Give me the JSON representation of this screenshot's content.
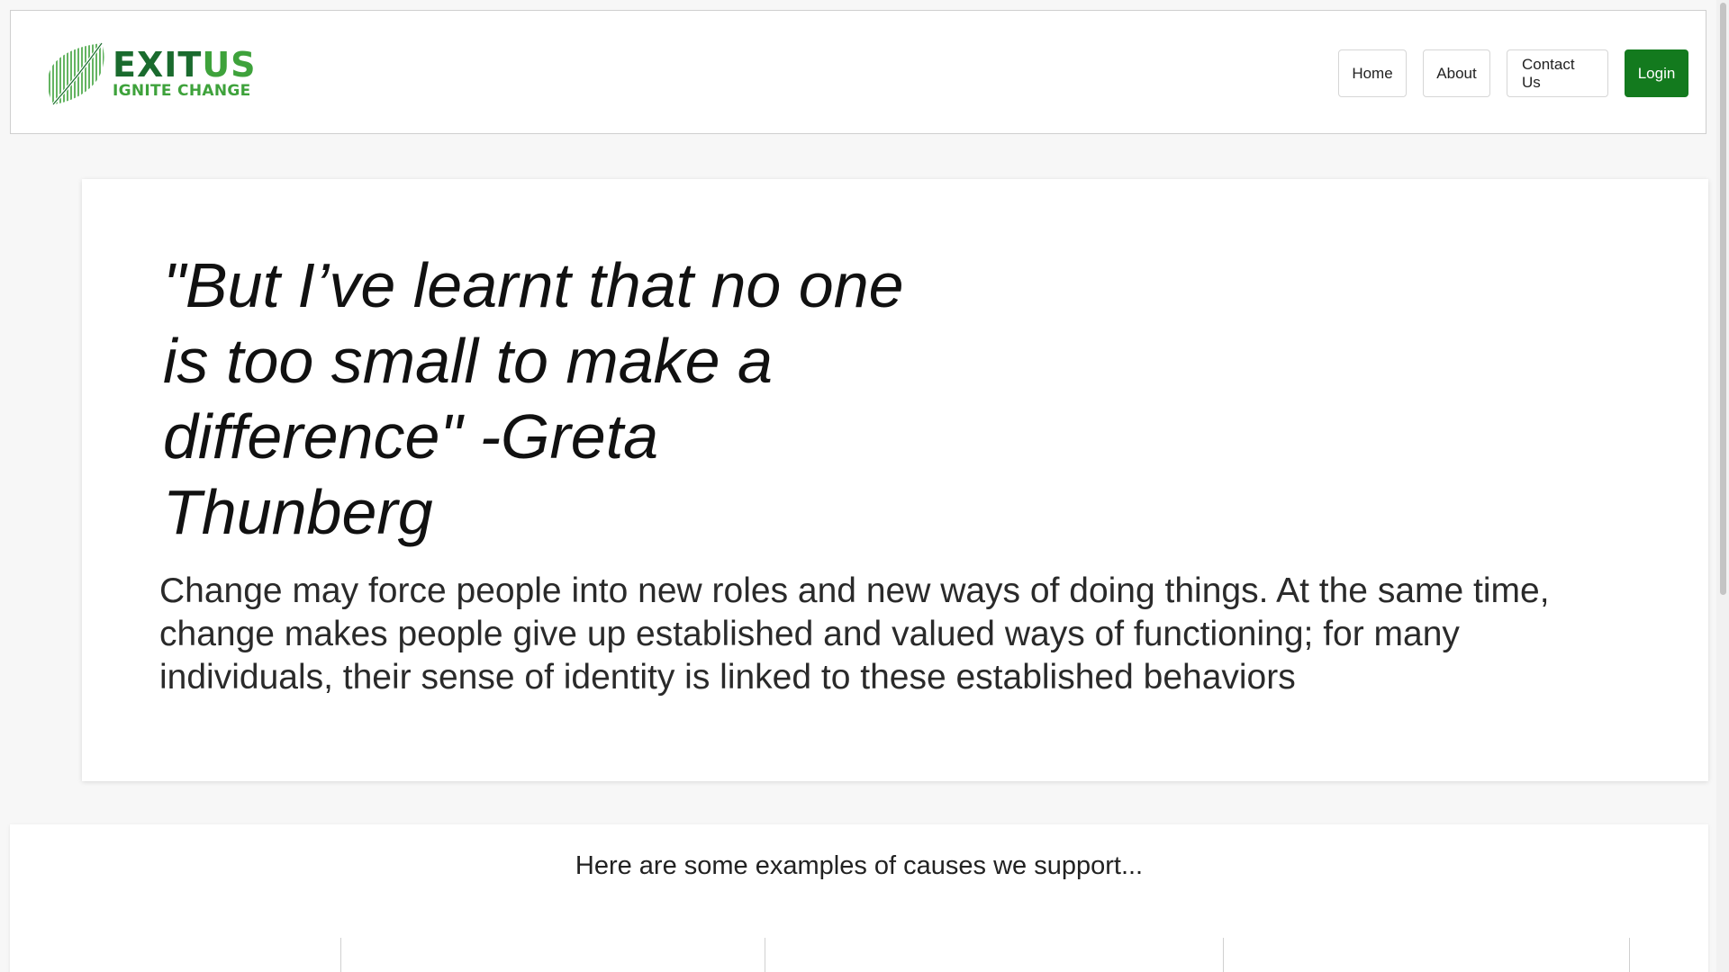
{
  "header": {
    "brand_name_main": "EXIT",
    "brand_name_alt": "US",
    "brand_tagline": "IGNITE CHANGE",
    "nav": {
      "home": "Home",
      "about": "About",
      "contact": "Contact Us",
      "login": "Login"
    }
  },
  "hero": {
    "quote": "\"But I’ve learnt that no one is too small to make a difference\" -Greta Thunberg",
    "body": "Change may force people into new roles and new ways of doing things. At the same time, change makes people give up established and valued ways of functioning; for many individuals, their sense of identity is linked to these established behaviors"
  },
  "causes": {
    "heading": "Here are some examples of causes we support..."
  },
  "colors": {
    "brand_dark_green": "#1a6b2e",
    "brand_light_green": "#3ea23b",
    "login_green": "#137a1e"
  },
  "icons": {
    "logo": "leaf-logo-icon"
  }
}
